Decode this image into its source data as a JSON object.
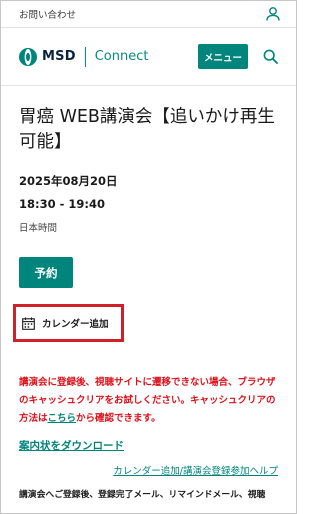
{
  "topbar": {
    "contact_label": "お問い合わせ",
    "user_icon": "user-icon"
  },
  "header": {
    "logo_text": "MSD",
    "logo_suffix": "Connect",
    "menu_label": "メニュー",
    "search_icon": "search-icon"
  },
  "event": {
    "title": "胃癌 WEB講演会【追いかけ再生可能】",
    "date": "2025年08月20日",
    "time": "18:30 -  19:40",
    "timezone": "日本時間"
  },
  "actions": {
    "reserve_label": "予約",
    "calendar_label": "カレンダー追加",
    "calendar_icon": "calendar-icon"
  },
  "notice": {
    "text_before": "講演会に登録後、視聴サイトに遷移できない場合、ブラウザのキャッシュクリアをお試しください。キャッシュクリアの方法は",
    "link_text": "こちら",
    "text_after": "から確認できます。"
  },
  "links": {
    "download_label": "案内状をダウンロード",
    "help_label": "カレンダー追加/講演会登録参加ヘルプ"
  },
  "footer_text": "講演会へご登録後、登録完了メール、リマインドメール、視聴",
  "colors": {
    "brand_teal": "#00857c",
    "alert_red": "#e0101a",
    "highlight_red": "#d2202a",
    "logo_navy": "#0c2340"
  }
}
